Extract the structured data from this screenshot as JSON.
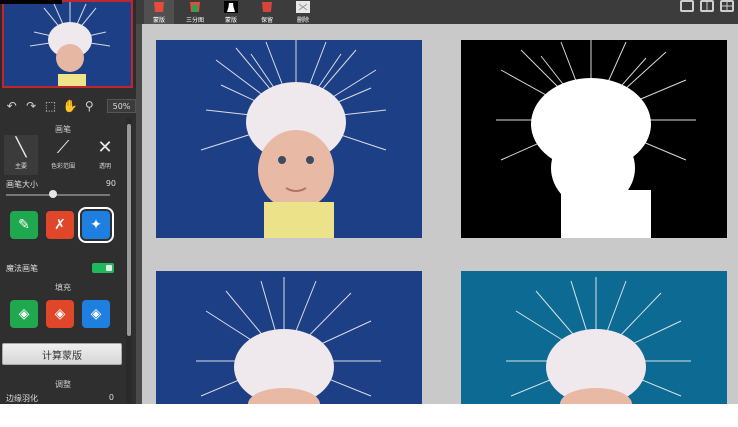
{
  "tabs": [
    {
      "label": "蒙版",
      "icon": "mask-layer-icon",
      "color": "#e64b3b"
    },
    {
      "label": "三分图",
      "icon": "trimap-icon",
      "color": "#2aa44f"
    },
    {
      "label": "蒙版",
      "icon": "mask-silhouette-icon",
      "color": "#ffffff"
    },
    {
      "label": "保留",
      "icon": "keep-icon",
      "color": "#d6453b"
    },
    {
      "label": "删除",
      "icon": "delete-icon",
      "color": "#cccccc"
    }
  ],
  "toolbar": {
    "zoom": "50%"
  },
  "brush": {
    "title": "画笔",
    "types": [
      {
        "label": "主要",
        "icon": "brush-main-icon"
      },
      {
        "label": "色彩范围",
        "icon": "brush-color-range-icon"
      },
      {
        "label": "透明",
        "icon": "brush-transparent-icon"
      }
    ],
    "size_label": "画笔大小",
    "size_value": "90",
    "size_level": 0.45
  },
  "magic_brush": {
    "label": "魔法画笔",
    "toggle_value": "1",
    "enabled": true
  },
  "fill": {
    "title": "填充"
  },
  "compute_button": {
    "label": "计算蒙版"
  },
  "adjust": {
    "title": "调整",
    "edge_label": "边缘羽化",
    "edge_value": "0"
  },
  "colors": {
    "accent_green": "#20a84f",
    "accent_red": "#e0462a",
    "accent_blue": "#1f7fe0",
    "thumb_border": "#c0262e"
  }
}
